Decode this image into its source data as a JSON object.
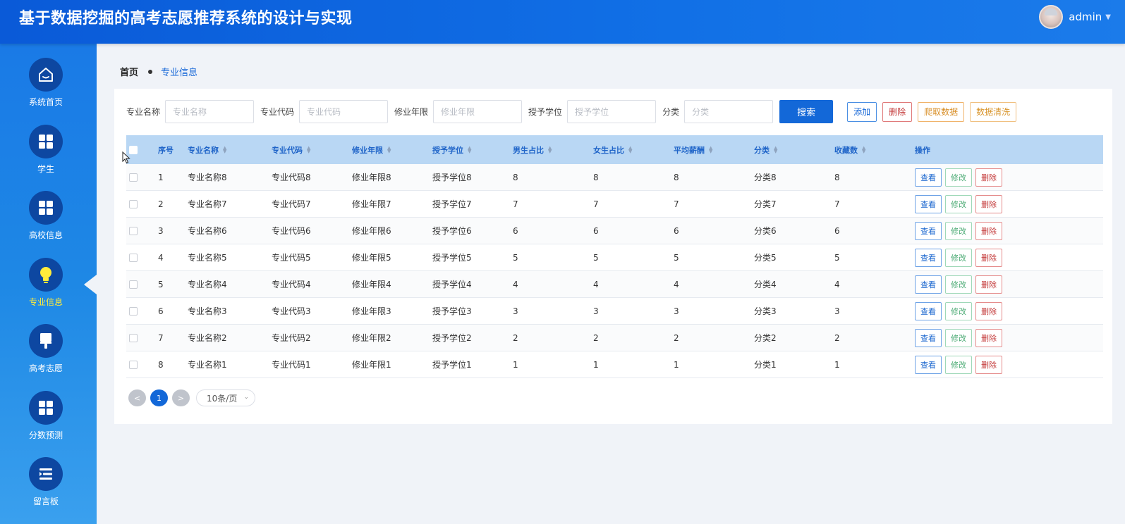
{
  "header": {
    "title": "基于数据挖掘的高考志愿推荐系统的设计与实现",
    "user": "admin"
  },
  "sidebar": {
    "items": [
      {
        "label": "系统首页",
        "icon": "home-icon"
      },
      {
        "label": "学生",
        "icon": "grid-icon"
      },
      {
        "label": "高校信息",
        "icon": "grid-icon"
      },
      {
        "label": "专业信息",
        "icon": "lightbulb-icon",
        "active": true
      },
      {
        "label": "高考志愿",
        "icon": "brush-icon"
      },
      {
        "label": "分数预测",
        "icon": "grid-icon"
      },
      {
        "label": "留言板",
        "icon": "list-icon"
      }
    ]
  },
  "breadcrumb": {
    "home": "首页",
    "current": "专业信息"
  },
  "search": {
    "fields": [
      {
        "label": "专业名称",
        "placeholder": "专业名称"
      },
      {
        "label": "专业代码",
        "placeholder": "专业代码"
      },
      {
        "label": "修业年限",
        "placeholder": "修业年限"
      },
      {
        "label": "授予学位",
        "placeholder": "授予学位"
      },
      {
        "label": "分类",
        "placeholder": "分类"
      }
    ],
    "search_label": "搜索",
    "add_label": "添加",
    "delete_label": "删除",
    "crawl_label": "爬取数据",
    "clean_label": "数据清洗"
  },
  "table": {
    "columns": [
      "序号",
      "专业名称",
      "专业代码",
      "修业年限",
      "授予学位",
      "男生占比",
      "女生占比",
      "平均薪酬",
      "分类",
      "收藏数",
      "操作"
    ],
    "rows": [
      [
        "1",
        "专业名称8",
        "专业代码8",
        "修业年限8",
        "授予学位8",
        "8",
        "8",
        "8",
        "分类8",
        "8"
      ],
      [
        "2",
        "专业名称7",
        "专业代码7",
        "修业年限7",
        "授予学位7",
        "7",
        "7",
        "7",
        "分类7",
        "7"
      ],
      [
        "3",
        "专业名称6",
        "专业代码6",
        "修业年限6",
        "授予学位6",
        "6",
        "6",
        "6",
        "分类6",
        "6"
      ],
      [
        "4",
        "专业名称5",
        "专业代码5",
        "修业年限5",
        "授予学位5",
        "5",
        "5",
        "5",
        "分类5",
        "5"
      ],
      [
        "5",
        "专业名称4",
        "专业代码4",
        "修业年限4",
        "授予学位4",
        "4",
        "4",
        "4",
        "分类4",
        "4"
      ],
      [
        "6",
        "专业名称3",
        "专业代码3",
        "修业年限3",
        "授予学位3",
        "3",
        "3",
        "3",
        "分类3",
        "3"
      ],
      [
        "7",
        "专业名称2",
        "专业代码2",
        "修业年限2",
        "授予学位2",
        "2",
        "2",
        "2",
        "分类2",
        "2"
      ],
      [
        "8",
        "专业名称1",
        "专业代码1",
        "修业年限1",
        "授予学位1",
        "1",
        "1",
        "1",
        "分类1",
        "1"
      ]
    ],
    "actions": {
      "view": "查看",
      "edit": "修改",
      "delete": "删除"
    }
  },
  "pagination": {
    "prev": "<",
    "current_page": "1",
    "next": ">",
    "page_size": "10条/页"
  }
}
